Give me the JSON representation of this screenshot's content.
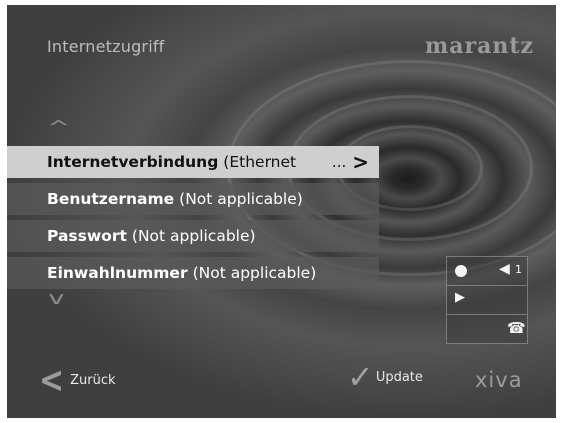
{
  "header": {
    "title": "Internetzugriff",
    "brand": "marantz"
  },
  "nav": {
    "up_arrow": "^",
    "down_arrow": "v"
  },
  "menu": {
    "items": [
      {
        "label": "Internetverbindung",
        "value": "(Ethernet",
        "suffix": "...",
        "chevron": ">"
      },
      {
        "label": "Benutzername",
        "value": "(Not applicable)"
      },
      {
        "label": "Passwort",
        "value": "(Not applicable)"
      },
      {
        "label": "Einwahlnummer",
        "value": "(Not applicable)"
      }
    ]
  },
  "status": {
    "volume_level": "1",
    "icons": [
      "record-icon",
      "speaker-icon",
      "play-icon",
      "phone-icon"
    ]
  },
  "footer": {
    "back_label": "Zurück",
    "update_label": "Update",
    "logo": "xiva"
  }
}
